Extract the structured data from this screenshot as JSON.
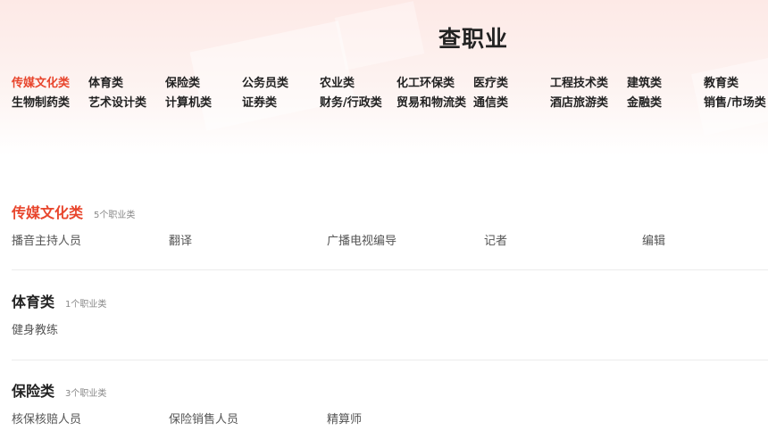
{
  "page": {
    "title": "查职业"
  },
  "categories": [
    "传媒文化类",
    "体育类",
    "保险类",
    "公务员类",
    "农业类",
    "化工环保类",
    "医疗类",
    "工程技术类",
    "建筑类",
    "教育类",
    "生物制药类",
    "艺术设计类",
    "计算机类",
    "证券类",
    "财务/行政类",
    "贸易和物流类",
    "通信类",
    "酒店旅游类",
    "金融类",
    "销售/市场类"
  ],
  "sections": [
    {
      "title": "传媒文化类",
      "count": "5个职业类",
      "jobs": [
        "播音主持人员",
        "翻译",
        "广播电视编导",
        "记者",
        "编辑"
      ]
    },
    {
      "title": "体育类",
      "count": "1个职业类",
      "jobs": [
        "健身教练"
      ]
    },
    {
      "title": "保险类",
      "count": "3个职业类",
      "jobs": [
        "核保核赔人员",
        "保险销售人员",
        "精算师"
      ]
    }
  ],
  "colors": {
    "accent": "#e8452c",
    "text": "#222222",
    "muted": "#888888"
  }
}
